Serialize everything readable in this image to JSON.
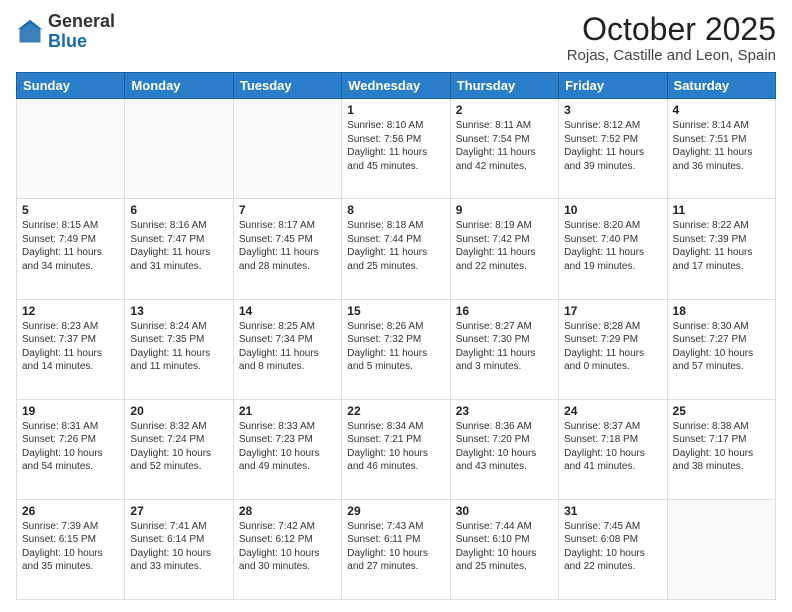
{
  "logo": {
    "general": "General",
    "blue": "Blue"
  },
  "header": {
    "month": "October 2025",
    "location": "Rojas, Castille and Leon, Spain"
  },
  "weekdays": [
    "Sunday",
    "Monday",
    "Tuesday",
    "Wednesday",
    "Thursday",
    "Friday",
    "Saturday"
  ],
  "weeks": [
    [
      {
        "day": "",
        "text": ""
      },
      {
        "day": "",
        "text": ""
      },
      {
        "day": "",
        "text": ""
      },
      {
        "day": "1",
        "text": "Sunrise: 8:10 AM\nSunset: 7:56 PM\nDaylight: 11 hours\nand 45 minutes."
      },
      {
        "day": "2",
        "text": "Sunrise: 8:11 AM\nSunset: 7:54 PM\nDaylight: 11 hours\nand 42 minutes."
      },
      {
        "day": "3",
        "text": "Sunrise: 8:12 AM\nSunset: 7:52 PM\nDaylight: 11 hours\nand 39 minutes."
      },
      {
        "day": "4",
        "text": "Sunrise: 8:14 AM\nSunset: 7:51 PM\nDaylight: 11 hours\nand 36 minutes."
      }
    ],
    [
      {
        "day": "5",
        "text": "Sunrise: 8:15 AM\nSunset: 7:49 PM\nDaylight: 11 hours\nand 34 minutes."
      },
      {
        "day": "6",
        "text": "Sunrise: 8:16 AM\nSunset: 7:47 PM\nDaylight: 11 hours\nand 31 minutes."
      },
      {
        "day": "7",
        "text": "Sunrise: 8:17 AM\nSunset: 7:45 PM\nDaylight: 11 hours\nand 28 minutes."
      },
      {
        "day": "8",
        "text": "Sunrise: 8:18 AM\nSunset: 7:44 PM\nDaylight: 11 hours\nand 25 minutes."
      },
      {
        "day": "9",
        "text": "Sunrise: 8:19 AM\nSunset: 7:42 PM\nDaylight: 11 hours\nand 22 minutes."
      },
      {
        "day": "10",
        "text": "Sunrise: 8:20 AM\nSunset: 7:40 PM\nDaylight: 11 hours\nand 19 minutes."
      },
      {
        "day": "11",
        "text": "Sunrise: 8:22 AM\nSunset: 7:39 PM\nDaylight: 11 hours\nand 17 minutes."
      }
    ],
    [
      {
        "day": "12",
        "text": "Sunrise: 8:23 AM\nSunset: 7:37 PM\nDaylight: 11 hours\nand 14 minutes."
      },
      {
        "day": "13",
        "text": "Sunrise: 8:24 AM\nSunset: 7:35 PM\nDaylight: 11 hours\nand 11 minutes."
      },
      {
        "day": "14",
        "text": "Sunrise: 8:25 AM\nSunset: 7:34 PM\nDaylight: 11 hours\nand 8 minutes."
      },
      {
        "day": "15",
        "text": "Sunrise: 8:26 AM\nSunset: 7:32 PM\nDaylight: 11 hours\nand 5 minutes."
      },
      {
        "day": "16",
        "text": "Sunrise: 8:27 AM\nSunset: 7:30 PM\nDaylight: 11 hours\nand 3 minutes."
      },
      {
        "day": "17",
        "text": "Sunrise: 8:28 AM\nSunset: 7:29 PM\nDaylight: 11 hours\nand 0 minutes."
      },
      {
        "day": "18",
        "text": "Sunrise: 8:30 AM\nSunset: 7:27 PM\nDaylight: 10 hours\nand 57 minutes."
      }
    ],
    [
      {
        "day": "19",
        "text": "Sunrise: 8:31 AM\nSunset: 7:26 PM\nDaylight: 10 hours\nand 54 minutes."
      },
      {
        "day": "20",
        "text": "Sunrise: 8:32 AM\nSunset: 7:24 PM\nDaylight: 10 hours\nand 52 minutes."
      },
      {
        "day": "21",
        "text": "Sunrise: 8:33 AM\nSunset: 7:23 PM\nDaylight: 10 hours\nand 49 minutes."
      },
      {
        "day": "22",
        "text": "Sunrise: 8:34 AM\nSunset: 7:21 PM\nDaylight: 10 hours\nand 46 minutes."
      },
      {
        "day": "23",
        "text": "Sunrise: 8:36 AM\nSunset: 7:20 PM\nDaylight: 10 hours\nand 43 minutes."
      },
      {
        "day": "24",
        "text": "Sunrise: 8:37 AM\nSunset: 7:18 PM\nDaylight: 10 hours\nand 41 minutes."
      },
      {
        "day": "25",
        "text": "Sunrise: 8:38 AM\nSunset: 7:17 PM\nDaylight: 10 hours\nand 38 minutes."
      }
    ],
    [
      {
        "day": "26",
        "text": "Sunrise: 7:39 AM\nSunset: 6:15 PM\nDaylight: 10 hours\nand 35 minutes."
      },
      {
        "day": "27",
        "text": "Sunrise: 7:41 AM\nSunset: 6:14 PM\nDaylight: 10 hours\nand 33 minutes."
      },
      {
        "day": "28",
        "text": "Sunrise: 7:42 AM\nSunset: 6:12 PM\nDaylight: 10 hours\nand 30 minutes."
      },
      {
        "day": "29",
        "text": "Sunrise: 7:43 AM\nSunset: 6:11 PM\nDaylight: 10 hours\nand 27 minutes."
      },
      {
        "day": "30",
        "text": "Sunrise: 7:44 AM\nSunset: 6:10 PM\nDaylight: 10 hours\nand 25 minutes."
      },
      {
        "day": "31",
        "text": "Sunrise: 7:45 AM\nSunset: 6:08 PM\nDaylight: 10 hours\nand 22 minutes."
      },
      {
        "day": "",
        "text": ""
      }
    ]
  ]
}
